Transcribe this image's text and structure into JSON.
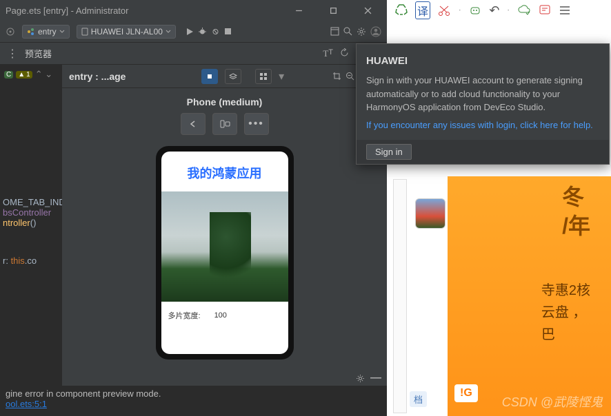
{
  "titlebar": {
    "title": "Page.ets [entry] - Administrator"
  },
  "toolbar": {
    "module": "entry",
    "device": "HUAWEI JLN-AL00"
  },
  "subbar": {
    "label": "预览器"
  },
  "code": {
    "c_badge": "C",
    "warnings": "1",
    "l1": "OME_TAB_IND",
    "l2a": "bsController",
    "l3a": "ntroller",
    "l3b": "()",
    "l4a": "r: ",
    "l4b": "this",
    "l4c": ".co"
  },
  "tab": {
    "path": "entry : ...age"
  },
  "device_label": "Phone (medium)",
  "app": {
    "title": "我的鸿蒙应用",
    "slider_label": "多片宽度:",
    "slider_value": "100"
  },
  "console": {
    "line1": "gine error in component preview mode.",
    "link": "ool.ets:5:1"
  },
  "popup": {
    "heading": "HUAWEI",
    "body": "Sign in with your HUAWEI account to generate signing automatically or to add cloud functionality to your HarmonyOS application from DevEco Studio.",
    "help_link": "If you encounter any issues with login, click here for help.",
    "signin": "Sign in"
  },
  "ad": {
    "l1": "冬",
    "l2": "/年",
    "l3": "寺惠2核",
    "l4": "云盘 ，",
    "l5": "巴",
    "l6": "!G",
    "l7": "档"
  },
  "watermark": "CSDN @武陵悭鬼"
}
